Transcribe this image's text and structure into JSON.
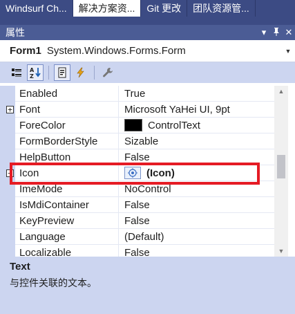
{
  "tabs": [
    {
      "label": "Windsurf Ch...",
      "active": false
    },
    {
      "label": "解决方案资...",
      "active": true
    },
    {
      "label": "Git 更改",
      "active": false
    },
    {
      "label": "团队资源管...",
      "active": false
    }
  ],
  "panel": {
    "title": "属性",
    "controls": {
      "dropdown": "▾",
      "pin": "📌",
      "close": "✕"
    }
  },
  "selector": {
    "object_name": "Form1",
    "object_type": "System.Windows.Forms.Form"
  },
  "toolbar": {
    "buttons": [
      "categorized-icon",
      "alphabetical-icon",
      "properties-icon",
      "events-icon",
      "property-pages-icon"
    ]
  },
  "properties": [
    {
      "name": "Enabled",
      "value": "True"
    },
    {
      "name": "Font",
      "value": "Microsoft YaHei UI, 9pt",
      "expandable": true
    },
    {
      "name": "ForeColor",
      "value": "ControlText",
      "swatch": "#000000"
    },
    {
      "name": "FormBorderStyle",
      "value": "Sizable"
    },
    {
      "name": "HelpButton",
      "value": "False"
    },
    {
      "name": "Icon",
      "value": "(Icon)",
      "expandable": true,
      "highlighted": true
    },
    {
      "name": "ImeMode",
      "value": "NoControl"
    },
    {
      "name": "IsMdiContainer",
      "value": "False"
    },
    {
      "name": "KeyPreview",
      "value": "False"
    },
    {
      "name": "Language",
      "value": "(Default)"
    },
    {
      "name": "Localizable",
      "value": "False"
    }
  ],
  "description": {
    "title": "Text",
    "text": "与控件关联的文本。"
  },
  "colors": {
    "tab_strip": "#3c4b84",
    "title_bar": "#4b5c95",
    "toolbar": "#ccd5f0",
    "highlight": "#e51b24"
  }
}
